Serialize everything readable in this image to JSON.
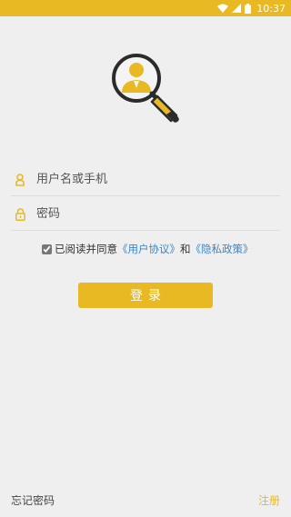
{
  "status_bar": {
    "time": "10:37",
    "icons": [
      "wifi-icon",
      "signal-icon",
      "battery-icon"
    ]
  },
  "logo": {
    "icon": "magnifier-user-icon"
  },
  "form": {
    "username": {
      "placeholder": "用户名或手机",
      "value": "",
      "icon": "user-icon"
    },
    "password": {
      "placeholder": "密码",
      "value": "",
      "icon": "lock-icon"
    },
    "agreement": {
      "checked": true,
      "prefix": "已阅读并同意",
      "user_agreement": "《用户协议》",
      "and": "和",
      "privacy_policy": "《隐私政策》"
    },
    "login_button": "登录"
  },
  "footer": {
    "forgot_password": "忘记密码",
    "register": "注册"
  },
  "colors": {
    "accent": "#e8b923",
    "link": "#3a86c8",
    "background": "#efefef"
  }
}
